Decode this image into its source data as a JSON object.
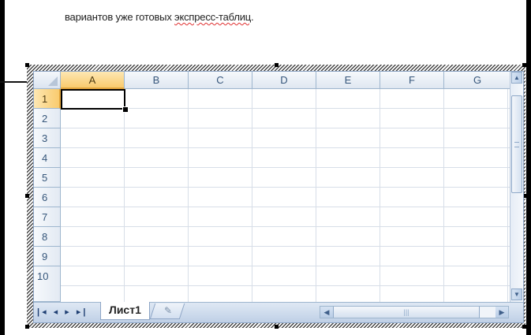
{
  "document": {
    "text_before": "вариантов уже готовых ",
    "text_squiggle": "экспресс-таблиц",
    "text_after": "."
  },
  "spreadsheet": {
    "columns": [
      "A",
      "B",
      "C",
      "D",
      "E",
      "F",
      "G"
    ],
    "rows": [
      "1",
      "2",
      "3",
      "4",
      "5",
      "6",
      "7",
      "8",
      "9",
      "10"
    ],
    "active_cell": "A1",
    "active_cell_value": "",
    "sheet_tab": "Лист1",
    "nav_buttons": "◀◀ ◀ ▶ ▶▶",
    "colors": {
      "header_bg": "#dfe7f1",
      "active_header": "#f9cb6e",
      "gridline": "#d7dee8",
      "header_text": "#35557a"
    }
  },
  "icons": {
    "nav_first": "first-sheet-icon",
    "nav_prev": "prev-sheet-icon",
    "nav_next": "next-sheet-icon",
    "nav_last": "last-sheet-icon",
    "new_sheet": "insert-worksheet-icon"
  }
}
